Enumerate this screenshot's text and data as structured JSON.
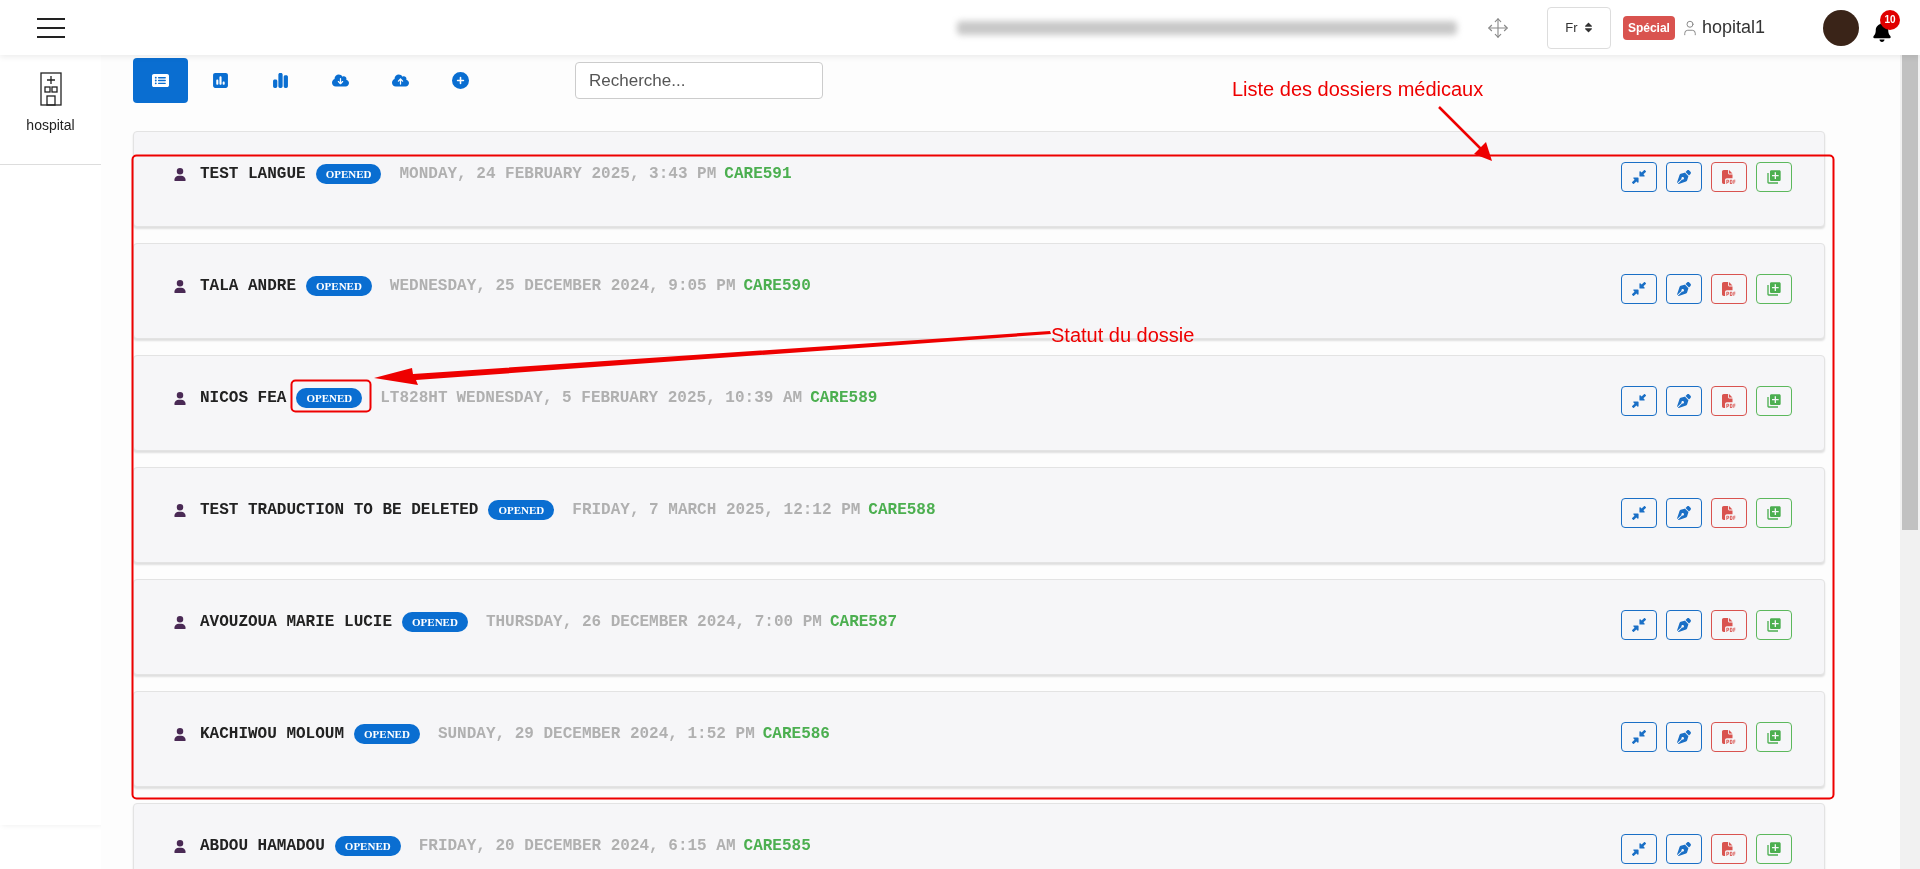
{
  "header": {
    "language": "Fr",
    "badge": "Spécial",
    "user": "hopital1",
    "notifications": "10"
  },
  "sidebar": {
    "items": [
      {
        "label": "hospital"
      }
    ]
  },
  "toolbar": [
    {
      "kind": "list",
      "selected": true
    },
    {
      "kind": "report",
      "selected": false
    },
    {
      "kind": "chart",
      "selected": false
    },
    {
      "kind": "download",
      "selected": false
    },
    {
      "kind": "upload",
      "selected": false
    },
    {
      "kind": "add",
      "selected": false
    }
  ],
  "search": {
    "placeholder": "Recherche..."
  },
  "records": [
    {
      "name": "TEST LANGUE",
      "status": "OPENED",
      "date": "MONDAY, 24 FEBRUARY 2025, 3:43 PM",
      "code": "CARE591"
    },
    {
      "name": "TALA ANDRE",
      "status": "OPENED",
      "date": "WEDNESDAY, 25 DECEMBER 2024, 9:05 PM",
      "code": "CARE590"
    },
    {
      "name": "NICOS FEA",
      "status": "OPENED",
      "ref": "LT828HT",
      "date": "WEDNESDAY, 5 FEBRUARY 2025, 10:39 AM",
      "code": "CARE589"
    },
    {
      "name": "TEST TRADUCTION TO BE DELETED",
      "status": "OPENED",
      "date": "FRIDAY, 7 MARCH 2025, 12:12 PM",
      "code": "CARE588"
    },
    {
      "name": "AVOUZOUA MARIE LUCIE",
      "status": "OPENED",
      "date": "THURSDAY, 26 DECEMBER 2024, 7:00 PM",
      "code": "CARE587"
    },
    {
      "name": "KACHIWOU MOLOUM",
      "status": "OPENED",
      "date": "SUNDAY, 29 DECEMBER 2024, 1:52 PM",
      "code": "CARE586"
    },
    {
      "name": "ABDOU HAMADOU",
      "status": "OPENED",
      "date": "FRIDAY, 20 DECEMBER 2024, 6:15 AM",
      "code": "CARE585"
    }
  ],
  "annotations": [
    {
      "kind": "list",
      "text": "Liste des dossiers médicaux"
    },
    {
      "kind": "status",
      "text": "Statut du dossie"
    }
  ]
}
